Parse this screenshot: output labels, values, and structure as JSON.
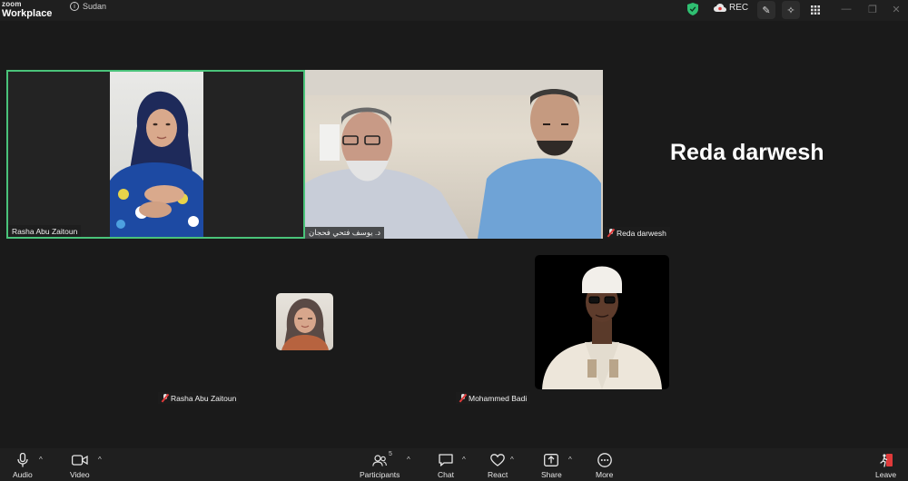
{
  "app": {
    "logo_line1": "zoom",
    "logo_line2": "Workplace"
  },
  "meeting": {
    "label": "Sudan"
  },
  "titlebar": {
    "rec_label": "REC"
  },
  "participants": {
    "rasha_tile_name": "Rasha Abu Zaitoun",
    "yousef_tile_name": "د. يوسف فتحي فحجان",
    "reda_tile_name": "Reda darwesh",
    "reda_big_name": "Reda darwesh",
    "rasha_small_name": "Rasha Abu Zaitoun",
    "mohammed_name": "Mohammed Badi"
  },
  "toolbar": {
    "audio": "Audio",
    "video": "Video",
    "participants": "Participants",
    "participants_count": "5",
    "chat": "Chat",
    "react": "React",
    "share": "Share",
    "more": "More",
    "leave": "Leave"
  },
  "colors": {
    "active_speaker_border": "#4ac37a",
    "shield": "#2fbf71",
    "leave": "#e03a3a"
  },
  "icons": [
    "info-icon",
    "shield-icon",
    "cloud-rec-icon",
    "pen-icon",
    "sparkle-icon",
    "grid-icon",
    "mic-icon",
    "camera-icon",
    "participants-icon",
    "chat-icon",
    "heart-icon",
    "share-icon",
    "more-icon",
    "leave-icon",
    "mic-off-icon"
  ]
}
